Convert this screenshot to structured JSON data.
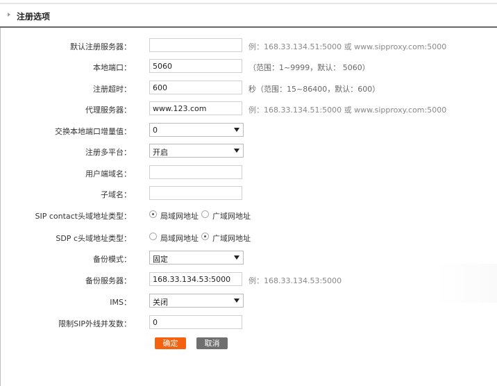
{
  "header": {
    "title": "注册选项"
  },
  "fields": {
    "default_server": {
      "label": "默认注册服务器：",
      "value": "",
      "hint": "例：168.33.134.51:5000 或 www.sipproxy.com:5000"
    },
    "local_port": {
      "label": "本地端口：",
      "value": "5060",
      "hint": "（范围：1~9999，默认： 5060）"
    },
    "reg_timeout": {
      "label": "注册超时：",
      "value": "600",
      "hint": "秒（范围：15~86400，默认：600）"
    },
    "proxy_server": {
      "label": "代理服务器：",
      "value": "www.123.com",
      "hint": "例：168.33.134.51:5000 或 www.sipproxy.com:5000"
    },
    "port_increment": {
      "label": "交换本地端口增量值：",
      "value": "0"
    },
    "multi_platform": {
      "label": "注册多平台：",
      "value": "开启"
    },
    "user_domain": {
      "label": "用户端域名：",
      "value": ""
    },
    "sub_domain": {
      "label": "子域名：",
      "value": ""
    },
    "sip_contact": {
      "label": "SIP contact头域地址类型：",
      "opt1": "局域网地址",
      "opt2": "广域网地址",
      "selected": "局域网地址"
    },
    "sdp_c": {
      "label": "SDP c头域地址类型：",
      "opt1": "局域网地址",
      "opt2": "广域网地址",
      "selected": "广域网地址"
    },
    "backup_mode": {
      "label": "备份模式：",
      "value": "固定"
    },
    "backup_server": {
      "label": "备份服务器：",
      "value": "168.33.134.53:5000",
      "hint": "例：168.33.134.53:5000"
    },
    "ims": {
      "label": "IMS：",
      "value": "关闭"
    },
    "sip_limit": {
      "label": "限制SIP外线并发数：",
      "value": "0"
    }
  },
  "buttons": {
    "ok": "确定",
    "cancel": "取消"
  },
  "colors": {
    "primary": "#f5620f",
    "secondary": "#6f6f6f"
  }
}
